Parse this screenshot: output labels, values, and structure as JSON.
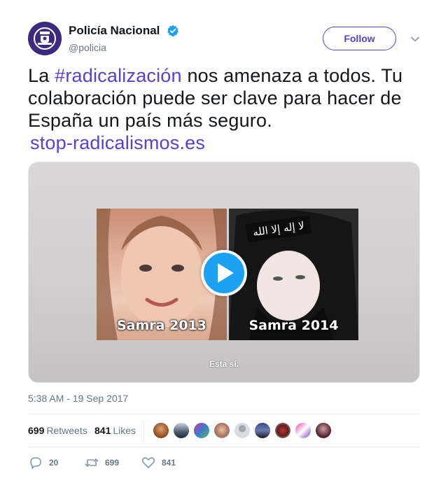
{
  "author": {
    "display_name": "Policía Nacional",
    "handle": "@policia",
    "verified": true,
    "avatar_icon": "police-badge-icon",
    "avatar_color": "#3b2a80"
  },
  "header": {
    "follow_label": "Follow",
    "menu_icon": "chevron-down-icon"
  },
  "tweet": {
    "text_before": "La ",
    "hashtag": "#radicalización",
    "text_after": " nos amenaza a todos. Tu colaboración puede ser clave para hacer de España un país más seguro.",
    "link": "stop-radicalismos.es",
    "accent_color": "#5b3fd1"
  },
  "media": {
    "type": "video",
    "left_label": "Samra 2013",
    "right_label": "Samra 2014",
    "banner_text": "لا إله إلا الله",
    "caption": "Esta sí.",
    "play_icon": "play-icon",
    "play_color": "#1da1f2"
  },
  "timestamp": "5:38 AM - 19 Sep 2017",
  "stats": {
    "retweets_count": "699",
    "retweets_label": "Retweets",
    "likes_count": "841",
    "likes_label": "Likes",
    "liker_avatars": 9
  },
  "actions": {
    "replies": "20",
    "retweets": "699",
    "likes": "841"
  }
}
